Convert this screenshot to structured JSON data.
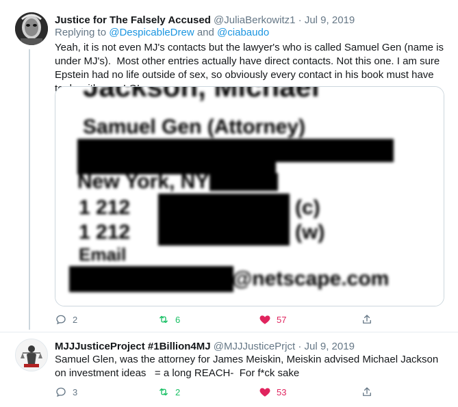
{
  "tweet1": {
    "display_name": "Justice for The Falsely Accused",
    "handle": "@JuliaBerkowitz1",
    "date": "Jul 9, 2019",
    "replying_prefix": "Replying to ",
    "reply_user1": "@DespicableDrew",
    "reply_and": " and ",
    "reply_user2": "@ciabaudo",
    "text": "Yeah, it is not even MJ's contacts but the lawyer's who is called Samuel Gen (name is under MJ's).  Most other entries actually have direct contacts. Not this one. I am sure Epstein had no life outside of sex, so obviously every contact in his book must have to do with sex. LOL.",
    "image_text": {
      "line1": "Jackson, Michael",
      "line2": "Samuel Gen (Attorney)",
      "line3": "New York, NY",
      "line4a": "1 212",
      "line4b": "(c)",
      "line5a": "1 212",
      "line5b": "(w)",
      "line6": "Email",
      "line7": "@netscape.com"
    },
    "replies": "2",
    "retweets": "6",
    "likes": "57"
  },
  "tweet2": {
    "display_name": "MJJJusticeProject #1Billion4MJ",
    "handle": "@MJJJusticePrjct",
    "date": "Jul 9, 2019",
    "text": "Samuel Glen, was the attorney for James Meiskin, Meiskin advised Michael Jackson on investment ideas   = a long REACH-  For f*ck sake",
    "replies": "3",
    "retweets": "2",
    "likes": "53"
  },
  "separator": " · ",
  "colors": {
    "link": "#1b95e0",
    "retweet": "#17bf63",
    "like": "#e0245e",
    "muted": "#657786",
    "border": "#ccd6dd"
  },
  "icons": [
    "reply-icon",
    "retweet-icon",
    "heart-icon",
    "share-icon"
  ]
}
